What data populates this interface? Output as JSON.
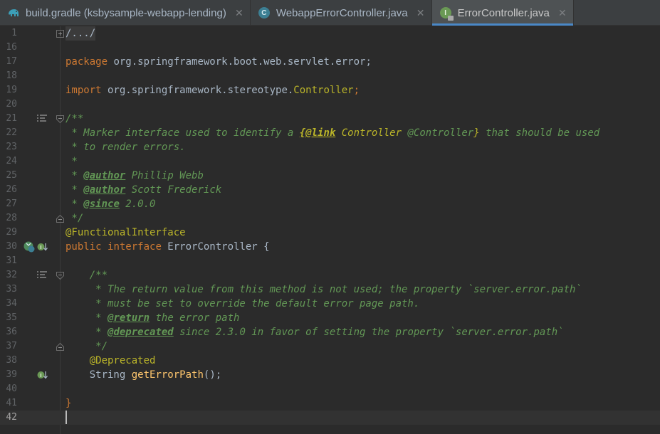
{
  "tabs": [
    {
      "label": "build.gradle (ksbysample-webapp-lending)",
      "icon": "gradle-elephant-icon",
      "active": false
    },
    {
      "label": "WebappErrorController.java",
      "icon": "class-icon",
      "active": false
    },
    {
      "label": "ErrorController.java",
      "icon": "interface-icon",
      "active": true
    }
  ],
  "icons": {
    "class_letter": "C",
    "interface_letter": "I",
    "close": "✕"
  },
  "colors": {
    "background": "#2b2b2b",
    "keyword": "#cc7832",
    "annotation": "#bbb529",
    "doc": "#629755",
    "function": "#ffc66d",
    "text": "#a9b7c6",
    "accent": "#4a88c7"
  },
  "lines": [
    {
      "n": "1",
      "code": "/.../"
    },
    {
      "n": "16",
      "code": ""
    },
    {
      "n": "17",
      "kw": "package",
      "rest": " org.springframework.boot.web.servlet.error;"
    },
    {
      "n": "18",
      "code": ""
    },
    {
      "n": "19",
      "kw": "import",
      "rest": " org.springframework.stereotype.",
      "ref": "Controller",
      "end": ";"
    },
    {
      "n": "20",
      "code": ""
    },
    {
      "n": "21",
      "doc": "/**"
    },
    {
      "n": "22",
      "doc_a": " * Marker interface used to identify a ",
      "link": "{@link",
      "ref": "Controller",
      "doc_b": " @Controller",
      "link_end": "}",
      "doc_c": " that should be used"
    },
    {
      "n": "23",
      "doc": " * to render errors."
    },
    {
      "n": "24",
      "doc": " *"
    },
    {
      "n": "25",
      "pre": " * ",
      "tag": "@author",
      "post": " Phillip Webb"
    },
    {
      "n": "26",
      "pre": " * ",
      "tag": "@author",
      "post": " Scott Frederick"
    },
    {
      "n": "27",
      "pre": " * ",
      "tag": "@since",
      "post": " 2.0.0"
    },
    {
      "n": "28",
      "doc": " */"
    },
    {
      "n": "29",
      "ann": "@FunctionalInterface"
    },
    {
      "n": "30",
      "kw1": "public",
      "sp": " ",
      "kw2": "interface",
      "rest": " ErrorController {"
    },
    {
      "n": "31",
      "code": ""
    },
    {
      "n": "32",
      "doc": "    /**"
    },
    {
      "n": "33",
      "doc": "     * The return value from this method is not used; the property `server.error.path`"
    },
    {
      "n": "34",
      "doc": "     * must be set to override the default error page path."
    },
    {
      "n": "35",
      "pre": "     * ",
      "tag": "@return",
      "post": " the error path"
    },
    {
      "n": "36",
      "pre": "     * ",
      "tag": "@deprecated",
      "post": " since 2.3.0 in favor of setting the property `server.error.path`"
    },
    {
      "n": "37",
      "doc": "     */"
    },
    {
      "n": "38",
      "indent": "    ",
      "ann": "@Deprecated"
    },
    {
      "n": "39",
      "indent": "    ",
      "type": "String ",
      "fn": "getErrorPath",
      "end": "();"
    },
    {
      "n": "40",
      "code": ""
    },
    {
      "n": "41",
      "kw": "}"
    },
    {
      "n": "42",
      "code": ""
    }
  ]
}
